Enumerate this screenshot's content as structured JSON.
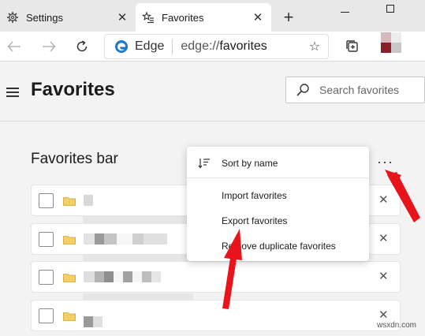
{
  "tabs": [
    {
      "title": "Settings",
      "icon": "gear-icon",
      "active": false
    },
    {
      "title": "Favorites",
      "icon": "favorites-star-icon",
      "active": true
    }
  ],
  "toolbar": {
    "edge_label": "Edge",
    "url_prefix": "edge://",
    "url_path": "favorites"
  },
  "page": {
    "title": "Favorites",
    "search_placeholder": "Search favorites",
    "section_title": "Favorites bar",
    "section_more": "···"
  },
  "menu": {
    "items": [
      {
        "label": "Sort by name",
        "icon": "sort-icon"
      },
      {
        "label": "Import favorites"
      },
      {
        "label": "Export favorites"
      },
      {
        "label": "Remove duplicate favorites"
      }
    ]
  },
  "rows": [
    {
      "icon": "folder-icon",
      "name_obscured": true
    },
    {
      "icon": "folder-icon",
      "name_obscured": true
    },
    {
      "icon": "folder-icon",
      "name_obscured": true
    },
    {
      "icon": "folder-icon",
      "name_obscured": true
    }
  ],
  "colors": {
    "accent_arrow": "#e8141b",
    "folder": "#f4cf63",
    "edge_blue": "#1e78c8"
  },
  "watermark": "wsxdn.com"
}
